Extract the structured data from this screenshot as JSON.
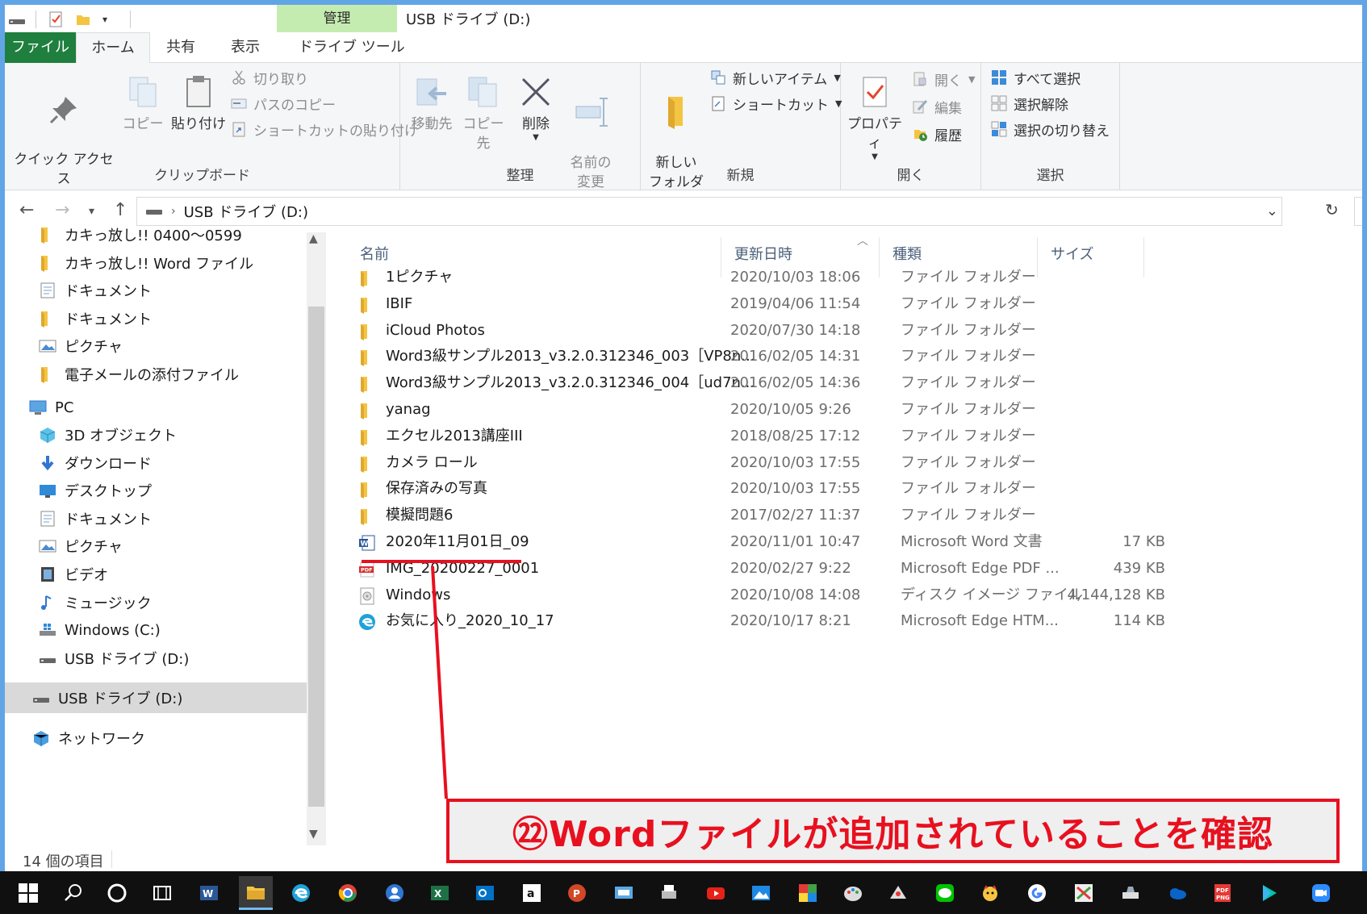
{
  "window": {
    "title": "USB ドライブ (D:)",
    "manage_tab": "管理"
  },
  "tabs": {
    "file": "ファイル",
    "home": "ホーム",
    "share": "共有",
    "view": "表示",
    "drive_tools": "ドライブ ツール"
  },
  "ribbon": {
    "clipboard": {
      "label": "クリップボード",
      "pin": "クイック アクセス\nにピン留めする",
      "copy": "コピー",
      "paste": "貼り付け",
      "cut": "切り取り",
      "copy_path": "パスのコピー",
      "paste_shortcut": "ショートカットの貼り付け"
    },
    "organize": {
      "label": "整理",
      "move_to": "移動先",
      "copy_to": "コピー先",
      "delete": "削除",
      "rename": "名前の\n変更"
    },
    "new": {
      "label": "新規",
      "new_folder": "新しい\nフォルダー",
      "new_item": "新しいアイテム",
      "shortcut": "ショートカット"
    },
    "open": {
      "label": "開く",
      "properties": "プロパティ",
      "open": "開く",
      "edit": "編集",
      "history": "履歴"
    },
    "select": {
      "label": "選択",
      "select_all": "すべて選択",
      "select_none": "選択解除",
      "invert": "選択の切り替え"
    }
  },
  "address": {
    "path": "USB ドライブ (D:)"
  },
  "nav": {
    "quick_items": [
      {
        "label": "カキっ放し!! 0400～0599",
        "icon": "folder-icon"
      },
      {
        "label": "カキっ放し!! Word ファイル",
        "icon": "folder-icon"
      },
      {
        "label": "ドキュメント",
        "icon": "document-icon"
      },
      {
        "label": "ドキュメント",
        "icon": "folder-icon"
      },
      {
        "label": "ピクチャ",
        "icon": "pictures-icon"
      },
      {
        "label": "電子メールの添付ファイル",
        "icon": "folder-icon"
      }
    ],
    "pc": "PC",
    "pc_items": [
      {
        "label": "3D オブジェクト",
        "icon": "3d-objects-icon"
      },
      {
        "label": "ダウンロード",
        "icon": "download-icon"
      },
      {
        "label": "デスクトップ",
        "icon": "desktop-icon"
      },
      {
        "label": "ドキュメント",
        "icon": "document-icon"
      },
      {
        "label": "ピクチャ",
        "icon": "pictures-icon"
      },
      {
        "label": "ビデオ",
        "icon": "video-icon"
      },
      {
        "label": "ミュージック",
        "icon": "music-icon"
      },
      {
        "label": "Windows (C:)",
        "icon": "windows-drive-icon"
      },
      {
        "label": "USB ドライブ (D:)",
        "icon": "usb-drive-icon"
      }
    ],
    "usb": "USB ドライブ (D:)",
    "network": "ネットワーク"
  },
  "columns": {
    "name": "名前",
    "date": "更新日時",
    "type": "種類",
    "size": "サイズ"
  },
  "files": [
    {
      "name": "1ピクチャ",
      "date": "2020/10/03 18:06",
      "type": "ファイル フォルダー",
      "size": "",
      "icon": "folder-icon"
    },
    {
      "name": "IBIF",
      "date": "2019/04/06 11:54",
      "type": "ファイル フォルダー",
      "size": "",
      "icon": "folder-icon"
    },
    {
      "name": "iCloud Photos",
      "date": "2020/07/30 14:18",
      "type": "ファイル フォルダー",
      "size": "",
      "icon": "folder-icon"
    },
    {
      "name": "Word3級サンプル2013_v3.2.0.312346_003［VP8n...",
      "date": "2016/02/05 14:31",
      "type": "ファイル フォルダー",
      "size": "",
      "icon": "folder-icon"
    },
    {
      "name": "Word3級サンプル2013_v3.2.0.312346_004［ud7n...",
      "date": "2016/02/05 14:36",
      "type": "ファイル フォルダー",
      "size": "",
      "icon": "folder-icon"
    },
    {
      "name": "yanag",
      "date": "2020/10/05 9:26",
      "type": "ファイル フォルダー",
      "size": "",
      "icon": "folder-icon"
    },
    {
      "name": "エクセル2013講座III",
      "date": "2018/08/25 17:12",
      "type": "ファイル フォルダー",
      "size": "",
      "icon": "folder-icon"
    },
    {
      "name": "カメラ ロール",
      "date": "2020/10/03 17:55",
      "type": "ファイル フォルダー",
      "size": "",
      "icon": "folder-icon"
    },
    {
      "name": "保存済みの写真",
      "date": "2020/10/03 17:55",
      "type": "ファイル フォルダー",
      "size": "",
      "icon": "folder-icon"
    },
    {
      "name": "模擬問題6",
      "date": "2017/02/27 11:37",
      "type": "ファイル フォルダー",
      "size": "",
      "icon": "folder-icon"
    },
    {
      "name": "2020年11月01日_09",
      "date": "2020/11/01 10:47",
      "type": "Microsoft Word 文書",
      "size": "17 KB",
      "icon": "word-doc-icon"
    },
    {
      "name": "IMG_20200227_0001",
      "date": "2020/02/27 9:22",
      "type": "Microsoft Edge PDF ...",
      "size": "439 KB",
      "icon": "pdf-icon"
    },
    {
      "name": "Windows",
      "date": "2020/10/08 14:08",
      "type": "ディスク イメージ ファイル",
      "size": "4,144,128 KB",
      "icon": "disc-image-icon"
    },
    {
      "name": "お気に入り_2020_10_17",
      "date": "2020/10/17 8:21",
      "type": "Microsoft Edge HTM...",
      "size": "114 KB",
      "icon": "edge-html-icon"
    }
  ],
  "status": {
    "count": "14 個の項目"
  },
  "annotation": {
    "text": "㉒Wordファイルが追加されていることを確認"
  },
  "colors": {
    "file_tab": "#1f7f3e",
    "manage_tab": "#c5ecb0",
    "annotation": "#e8101f",
    "header_text": "#4c607a",
    "window_border": "#62a5e6"
  }
}
